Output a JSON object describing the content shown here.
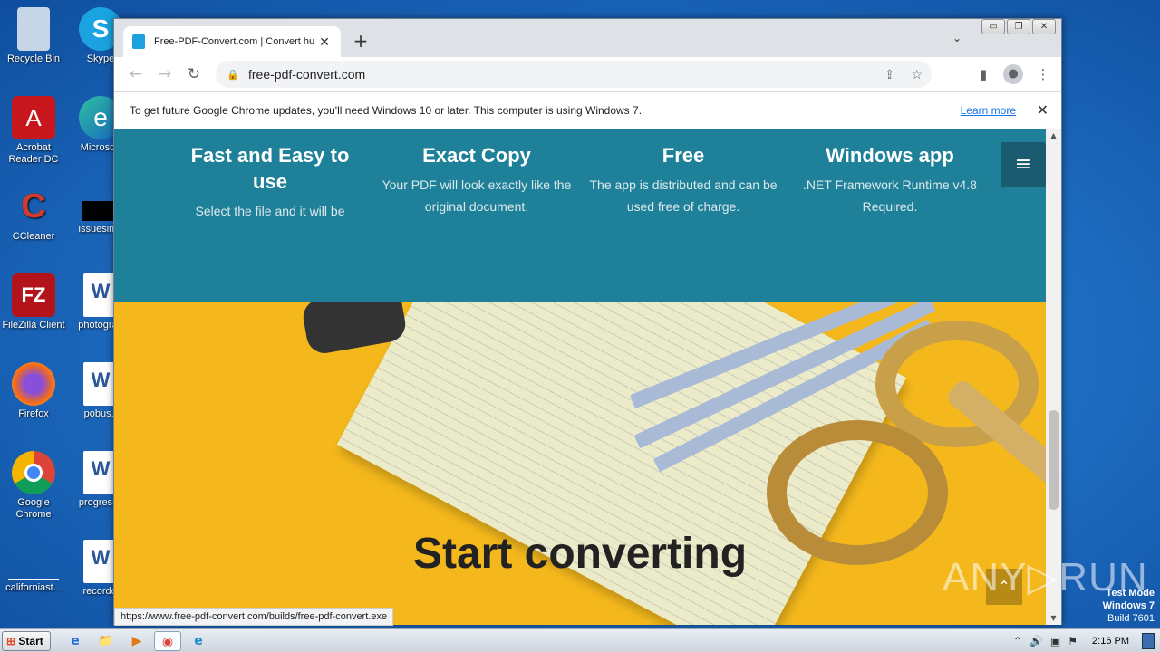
{
  "desktop": {
    "icons": [
      {
        "label": "Recycle Bin",
        "color": "#9fb4c9",
        "glyph": "🗑"
      },
      {
        "label": "Skype",
        "color": "#1aa3e0",
        "glyph": "S"
      },
      {
        "label": "Acrobat Reader DC",
        "color": "#c8161d",
        "glyph": "A"
      },
      {
        "label": "Microsoft",
        "color": "#2b8be0",
        "glyph": "e"
      },
      {
        "label": "CCleaner",
        "color": "#d23a2a",
        "glyph": "C"
      },
      {
        "label": "issuesimp",
        "color": "#000000",
        "glyph": ""
      },
      {
        "label": "FileZilla Client",
        "color": "#b3141b",
        "glyph": "FZ"
      },
      {
        "label": "photograp",
        "color": "#ffffff",
        "glyph": "W"
      },
      {
        "label": "Firefox",
        "color": "#e86a1a",
        "glyph": "🦊"
      },
      {
        "label": "pobus.r",
        "color": "#ffffff",
        "glyph": "W"
      },
      {
        "label": "Google Chrome",
        "color": "#ffffff",
        "glyph": "◉"
      },
      {
        "label": "progressc",
        "color": "#ffffff",
        "glyph": "W"
      },
      {
        "label": "californiast...",
        "color": "#1f6fc4",
        "glyph": ""
      },
      {
        "label": "recordcl",
        "color": "#ffffff",
        "glyph": "W"
      }
    ]
  },
  "browser": {
    "tab_title": "Free-PDF-Convert.com | Convert hu",
    "tab_close": "✕",
    "new_tab": "+",
    "tab_menu": "⌄",
    "win_min": "▭",
    "win_max": "❐",
    "win_close": "✕",
    "url": "free-pdf-convert.com",
    "back": "←",
    "forward": "→",
    "reload": "↻",
    "share_icon": "⇪",
    "star_icon": "☆",
    "sidepanel_icon": "▮",
    "profile_icon": "●",
    "menu_icon": "⋮",
    "infobar_text": "To get future Google Chrome updates, you'll need Windows 10 or later. This computer is using Windows 7.",
    "infobar_link": "Learn more",
    "infobar_close": "✕",
    "status_url": "https://www.free-pdf-convert.com/builds/free-pdf-convert.exe"
  },
  "page": {
    "features": [
      {
        "title": "Fast and Easy to use",
        "text": "Select the file and it will be"
      },
      {
        "title": "Exact Copy",
        "text": "Your PDF will look exactly like the original document."
      },
      {
        "title": "Free",
        "text": "The app is distributed and can be used free of charge."
      },
      {
        "title": "Windows app",
        "text": ".NET Framework Runtime v4.8 Required."
      }
    ],
    "menu_button": "≡",
    "headline": "Start converting",
    "scroll_top": "⌃"
  },
  "overlay": {
    "watermark": "ANY▷RUN",
    "test_mode_1": "Test Mode",
    "test_mode_2": "Windows 7",
    "test_mode_3": "Build 7601"
  },
  "taskbar": {
    "start_label": "Start",
    "time": "2:16 PM",
    "apps": [
      {
        "name": "ie",
        "glyph": "e"
      },
      {
        "name": "explorer",
        "glyph": "📁"
      },
      {
        "name": "media",
        "glyph": "▶"
      },
      {
        "name": "chrome",
        "glyph": "◉"
      },
      {
        "name": "edge",
        "glyph": "e"
      }
    ],
    "tray_up": "⌃",
    "tray_volume": "🔊",
    "tray_network": "▣",
    "tray_flag": "⚑"
  }
}
